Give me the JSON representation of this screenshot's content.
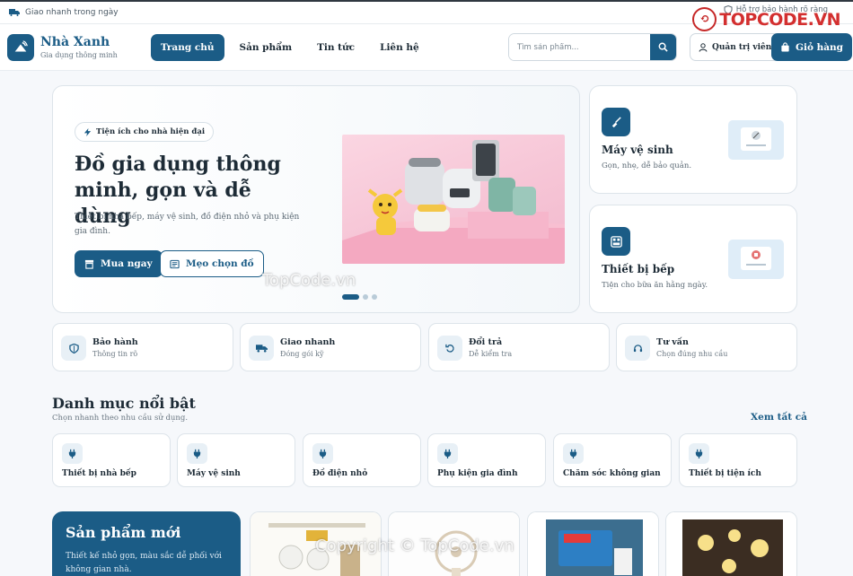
{
  "topbar": {
    "shipping_text": "Giao nhanh trong ngày",
    "support_text": "Hỗ trợ bảo hành rõ ràng"
  },
  "watermark": {
    "logo_text": "TOPCODE.VN",
    "center_text": "TopCode.vn",
    "footer_text": "Copyright © TopCode.vn"
  },
  "header": {
    "brand_name": "Nhà Xanh",
    "brand_sub": "Gia dụng thông minh",
    "nav": [
      "Trang chủ",
      "Sản phẩm",
      "Tin tức",
      "Liên hệ"
    ],
    "active_nav": "Trang chủ",
    "search_placeholder": "Tìm sản phẩm...",
    "admin_label": "Quản trị viên",
    "cart_label": "Giỏ hàng"
  },
  "hero": {
    "chip": "Tiện ích cho nhà hiện đại",
    "title": "Đồ gia dụng thông minh, gọn và dễ dùng",
    "description": "Thiết bị nhà bếp, máy vệ sinh, đồ điện nhỏ và phụ kiện gia đình.",
    "buy_button": "Mua ngay",
    "tips_button": "Mẹo chọn đồ",
    "slides_total": 3,
    "active_slide": 1
  },
  "side_cards": [
    {
      "title": "Máy vệ sinh",
      "subtitle": "Gọn, nhẹ, dễ bảo quản.",
      "icon": "broom-icon"
    },
    {
      "title": "Thiết bị bếp",
      "subtitle": "Tiện cho bữa ăn hằng ngày.",
      "icon": "kitchen-icon"
    }
  ],
  "features": [
    {
      "title": "Bảo hành",
      "subtitle": "Thông tin rõ",
      "icon": "shield-icon"
    },
    {
      "title": "Giao nhanh",
      "subtitle": "Đóng gói kỹ",
      "icon": "truck-icon"
    },
    {
      "title": "Đổi trả",
      "subtitle": "Dễ kiểm tra",
      "icon": "return-icon"
    },
    {
      "title": "Tư vấn",
      "subtitle": "Chọn đúng nhu cầu",
      "icon": "headset-icon"
    }
  ],
  "categories_section": {
    "title": "Danh mục nổi bật",
    "subtitle": "Chọn nhanh theo nhu cầu sử dụng.",
    "see_all": "Xem tất cả",
    "items": [
      "Thiết bị nhà bếp",
      "Máy vệ sinh",
      "Đồ điện nhỏ",
      "Phụ kiện gia đình",
      "Chăm sóc không gian",
      "Thiết bị tiện ích"
    ]
  },
  "new_products": {
    "title": "Sản phẩm mới",
    "description": "Thiết kế nhỏ gọn, màu sắc dễ phối với không gian nhà."
  },
  "colors": {
    "primary": "#1b5c86",
    "background": "#f6f8fb",
    "hero_image_pink": "#f6c5d6",
    "watermark_red": "#d32f2f"
  }
}
